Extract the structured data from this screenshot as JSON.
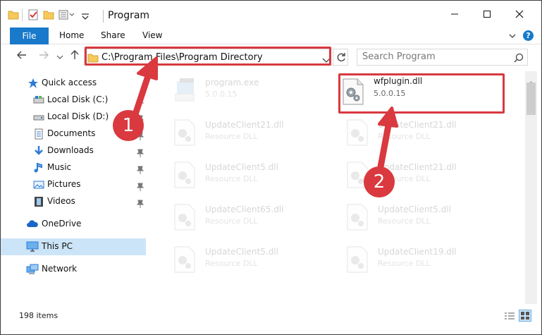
{
  "window": {
    "title": "Program",
    "buttons": {
      "minimize": "—",
      "maximize": "☐",
      "close": "✕"
    }
  },
  "ribbon": {
    "tabs": [
      "File",
      "Home",
      "Share",
      "View"
    ],
    "help": "?"
  },
  "nav": {
    "address": "C:\\Program Files\\Program Directory",
    "search_placeholder": "Search Program"
  },
  "sidebar": {
    "items": [
      {
        "label": "Quick access",
        "icon": "star-icon"
      },
      {
        "label": "Local Disk (C:)",
        "icon": "drive-icon",
        "pinned": true
      },
      {
        "label": "Local Disk (D:)",
        "icon": "drive-icon",
        "pinned": true
      },
      {
        "label": "Documents",
        "icon": "documents-icon",
        "pinned": true
      },
      {
        "label": "Downloads",
        "icon": "downloads-icon",
        "pinned": true
      },
      {
        "label": "Music",
        "icon": "music-icon",
        "pinned": true
      },
      {
        "label": "Pictures",
        "icon": "pictures-icon",
        "pinned": true
      },
      {
        "label": "Videos",
        "icon": "videos-icon",
        "pinned": true
      },
      {
        "label": "OneDrive",
        "icon": "cloud-icon"
      },
      {
        "label": "This PC",
        "icon": "pc-icon",
        "selected": true
      },
      {
        "label": "Network",
        "icon": "network-icon"
      }
    ]
  },
  "files": [
    {
      "name": "program.exe",
      "sub": "5.0.0.15",
      "icon": "exe-icon",
      "faded": true
    },
    {
      "name": "wfplugin.dll",
      "sub": "5.0.0.15",
      "icon": "dll-gear-icon",
      "faded": false,
      "highlighted": true
    },
    {
      "name": "UpdateClient21.dll",
      "sub": "Resource DLL",
      "icon": "dll-gear-icon",
      "faded": true
    },
    {
      "name": "UpdateClient21.dll",
      "sub": "Resource DLL",
      "icon": "dll-gear-icon",
      "faded": true
    },
    {
      "name": "UpdateClient5.dll",
      "sub": "Resource DLL",
      "icon": "dll-gear-icon",
      "faded": true
    },
    {
      "name": "UpdateClient21.dll",
      "sub": "Resource DLL",
      "icon": "dll-gear-icon",
      "faded": true
    },
    {
      "name": "UpdateClient65.dll",
      "sub": "Resource DLL",
      "icon": "dll-gear-icon",
      "faded": true
    },
    {
      "name": "UpdateClient5.dll",
      "sub": "Resource DLL",
      "icon": "dll-gear-icon",
      "faded": true
    },
    {
      "name": "UpdateClient5.dll",
      "sub": "Resource DLL",
      "icon": "dll-gear-icon",
      "faded": true
    },
    {
      "name": "UpdateClient19.dll",
      "sub": "Resource DLL",
      "icon": "dll-gear-icon",
      "faded": true
    }
  ],
  "status": {
    "count": "198 items"
  },
  "annotations": {
    "step1": "1",
    "step2": "2",
    "color": "#d9393f"
  },
  "colors": {
    "accent": "#1979ca",
    "selection": "#cce4f7",
    "highlight": "#d9393f"
  }
}
